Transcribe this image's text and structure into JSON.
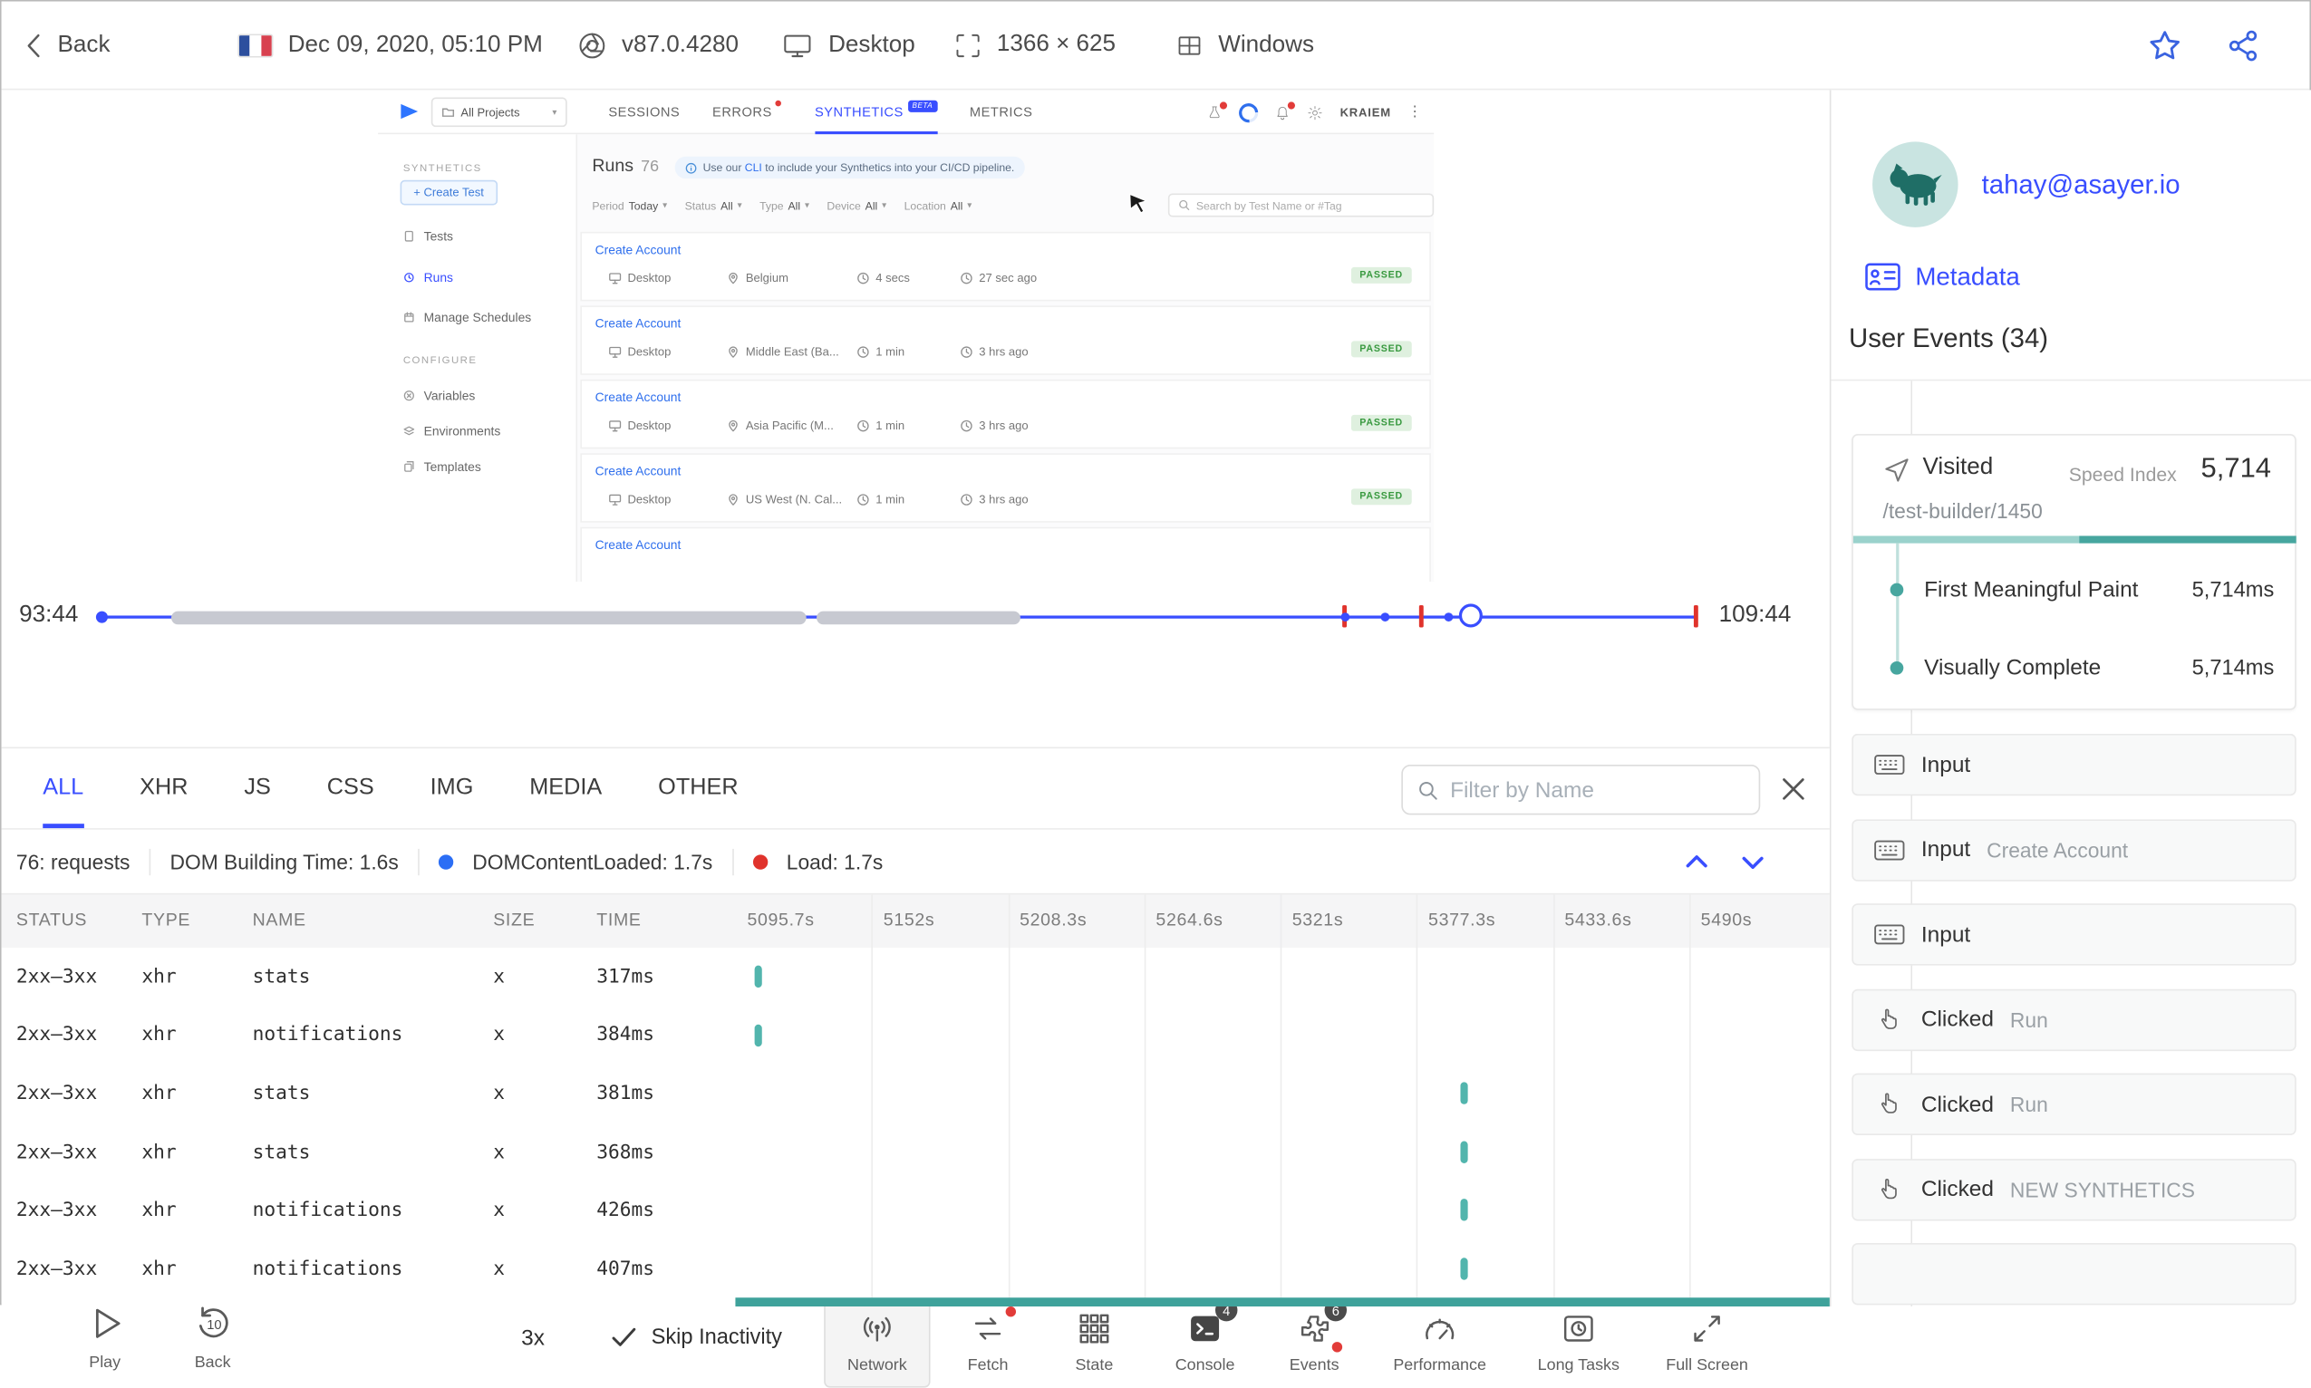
{
  "topbar": {
    "back": "Back",
    "datetime": "Dec 09, 2020, 05:10 PM",
    "browser": "v87.0.4280",
    "device": "Desktop",
    "resolution": "1366 × 625",
    "os": "Windows"
  },
  "replay": {
    "nav": {
      "projects": "All Projects",
      "tabs": [
        "SESSIONS",
        "ERRORS",
        "SYNTHETICS",
        "METRICS"
      ],
      "beta": "BETA",
      "user": "KRAIEM"
    },
    "sidebar": {
      "section_synthetics": "SYNTHETICS",
      "create_test": "+ Create Test",
      "items": [
        "Tests",
        "Runs",
        "Manage Schedules"
      ],
      "section_configure": "CONFIGURE",
      "config_items": [
        "Variables",
        "Environments",
        "Templates"
      ]
    },
    "content": {
      "title": "Runs",
      "count": "76",
      "banner": {
        "prefix": "Use our ",
        "link": "CLI",
        "suffix": " to include your Synthetics into your CI/CD pipeline."
      },
      "filters": [
        {
          "label": "Period",
          "value": "Today"
        },
        {
          "label": "Status",
          "value": "All"
        },
        {
          "label": "Type",
          "value": "All"
        },
        {
          "label": "Device",
          "value": "All"
        },
        {
          "label": "Location",
          "value": "All"
        }
      ],
      "search_placeholder": "Search by Test Name or #Tag",
      "runs": [
        {
          "name": "Create Account",
          "device": "Desktop",
          "location": "Belgium",
          "duration": "4 secs",
          "ago": "27 sec ago",
          "status": "PASSED"
        },
        {
          "name": "Create Account",
          "device": "Desktop",
          "location": "Middle East (Ba...",
          "duration": "1 min",
          "ago": "3 hrs ago",
          "status": "PASSED"
        },
        {
          "name": "Create Account",
          "device": "Desktop",
          "location": "Asia Pacific (M...",
          "duration": "1 min",
          "ago": "3 hrs ago",
          "status": "PASSED"
        },
        {
          "name": "Create Account",
          "device": "Desktop",
          "location": "US West (N. Cal...",
          "duration": "1 min",
          "ago": "3 hrs ago",
          "status": "PASSED"
        },
        {
          "name": "Create Account"
        }
      ]
    }
  },
  "timeline": {
    "current": "93:44",
    "total": "109:44"
  },
  "controls": {
    "play": "Play",
    "back": "Back",
    "speed": "3x",
    "skip": "Skip Inactivity",
    "buttons": [
      {
        "label": "Network",
        "active": true
      },
      {
        "label": "Fetch",
        "dot": true
      },
      {
        "label": "State"
      },
      {
        "label": "Console",
        "badge": "4"
      },
      {
        "label": "Events",
        "badge": "6",
        "dot": true
      },
      {
        "label": "Performance"
      },
      {
        "label": "Long Tasks"
      },
      {
        "label": "Full Screen"
      }
    ]
  },
  "network": {
    "tabs": [
      "ALL",
      "XHR",
      "JS",
      "CSS",
      "IMG",
      "MEDIA",
      "OTHER"
    ],
    "active_tab": "ALL",
    "filter_placeholder": "Filter by Name",
    "summary": {
      "requests": "76: requests",
      "dom_building": "DOM Building Time: 1.6s",
      "dom_content_loaded": "DOMContentLoaded: 1.7s",
      "load": "Load: 1.7s"
    },
    "columns": [
      "STATUS",
      "TYPE",
      "NAME",
      "SIZE",
      "TIME"
    ],
    "time_columns": [
      "5095.7s",
      "5152s",
      "5208.3s",
      "5264.6s",
      "5321s",
      "5377.3s",
      "5433.6s",
      "5490s"
    ],
    "rows": [
      {
        "status": "2xx–3xx",
        "type": "xhr",
        "name": "stats",
        "size": "x",
        "time": "317ms",
        "bar_col": 0,
        "bar_frac": 0.14
      },
      {
        "status": "2xx–3xx",
        "type": "xhr",
        "name": "notifications",
        "size": "x",
        "time": "384ms",
        "bar_col": 0,
        "bar_frac": 0.14
      },
      {
        "status": "2xx–3xx",
        "type": "xhr",
        "name": "stats",
        "size": "x",
        "time": "381ms",
        "bar_col": 5,
        "bar_frac": 0.32
      },
      {
        "status": "2xx–3xx",
        "type": "xhr",
        "name": "stats",
        "size": "x",
        "time": "368ms",
        "bar_col": 5,
        "bar_frac": 0.32
      },
      {
        "status": "2xx–3xx",
        "type": "xhr",
        "name": "notifications",
        "size": "x",
        "time": "426ms",
        "bar_col": 5,
        "bar_frac": 0.32
      },
      {
        "status": "2xx–3xx",
        "type": "xhr",
        "name": "notifications",
        "size": "x",
        "time": "407ms",
        "bar_col": 5,
        "bar_frac": 0.32
      }
    ]
  },
  "user_panel": {
    "email": "tahay@asayer.io",
    "metadata_label": "Metadata",
    "events_title": "User Events (34)",
    "visited_card": {
      "label": "Visited",
      "speed_index_label": "Speed Index",
      "speed_index": "5,714",
      "url": "/test-builder/1450",
      "metrics": [
        {
          "label": "First Meaningful Paint",
          "value": "5,714ms"
        },
        {
          "label": "Visually Complete",
          "value": "5,714ms"
        }
      ]
    },
    "events": [
      {
        "type": "Input",
        "detail": ""
      },
      {
        "type": "Input",
        "detail": "Create Account"
      },
      {
        "type": "Input",
        "detail": ""
      },
      {
        "type": "Clicked",
        "detail": "Run"
      },
      {
        "type": "Clicked",
        "detail": "Run"
      },
      {
        "type": "Clicked",
        "detail": "NEW SYNTHETICS"
      }
    ]
  },
  "colors": {
    "accent": "#394eff",
    "teal": "#47a69f",
    "teal_light": "#9ad2cc",
    "green": "#38993f",
    "red": "#e0332c"
  }
}
